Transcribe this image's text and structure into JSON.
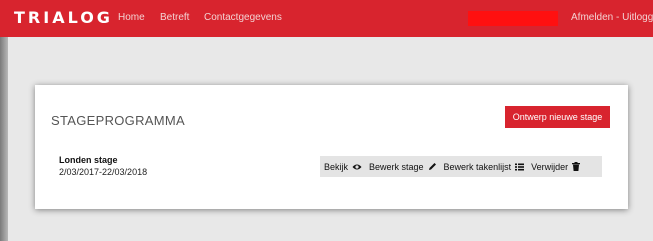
{
  "header": {
    "logo": "TRIALOG",
    "nav": [
      "Home",
      "Betreft",
      "Contactgegevens"
    ],
    "logout": "Afmelden - Uitlogge"
  },
  "card": {
    "title": "STAGEPROGRAMMA",
    "design_button": "Ontwerp nieuwe stage",
    "stage": {
      "name": "Londen stage",
      "dates": "2/03/2017-22/03/2018"
    },
    "actions": [
      {
        "label": "Bekijk",
        "icon": "eye-icon"
      },
      {
        "label": "Bewerk stage",
        "icon": "pencil-icon"
      },
      {
        "label": "Bewerk takenlijst",
        "icon": "list-icon"
      },
      {
        "label": "Verwijder",
        "icon": "trash-icon"
      }
    ]
  },
  "colors": {
    "brand": "#d8242e",
    "redaction": "#ff1010",
    "background": "#e8e8e8"
  }
}
